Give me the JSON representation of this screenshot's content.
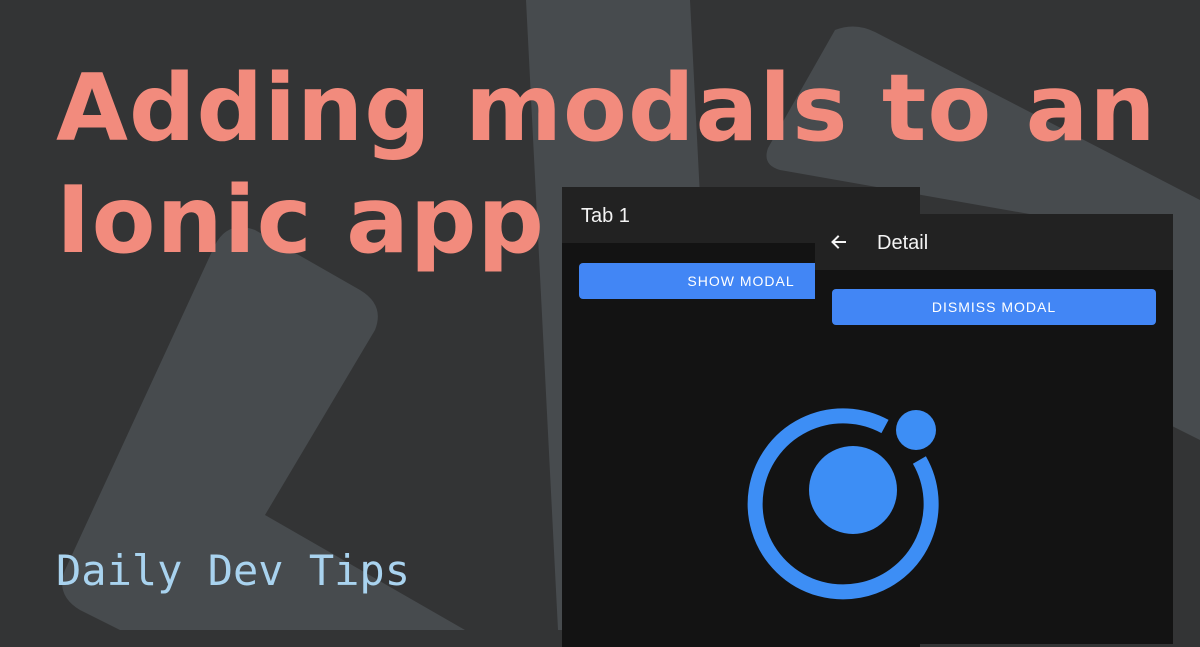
{
  "headline": {
    "line1": "Adding modals to an",
    "line2": "Ionic app"
  },
  "brand": "Daily Dev Tips",
  "tab_screen": {
    "toolbar_title": "Tab 1",
    "button_label": "SHOW MODAL"
  },
  "detail_screen": {
    "toolbar_title": "Detail",
    "back_icon": "arrow-back-icon",
    "button_label": "DISMISS MODAL"
  },
  "logo": "ionic-logo-icon",
  "colors": {
    "background": "#333435",
    "headline": "#f28b7d",
    "brand": "#a9d3ef",
    "button": "#4286f5",
    "ionic_blue": "#3d8ef5",
    "toolbar": "#222222",
    "screen": "#131313"
  }
}
